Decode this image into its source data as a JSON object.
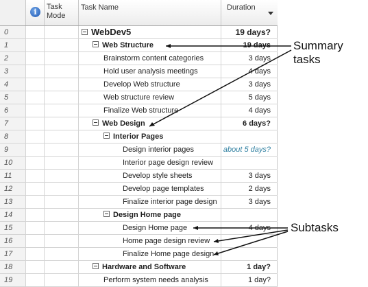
{
  "header": {
    "info_label": "i",
    "task_mode_label": "Task Mode",
    "task_name_label": "Task Name",
    "duration_label": "Duration"
  },
  "rows": [
    {
      "id": "0",
      "name": "WebDev5",
      "duration": "19 days?",
      "mode": "auto",
      "level": 0,
      "summary": true,
      "root": true
    },
    {
      "id": "1",
      "name": "Web Structure",
      "duration": "19 days",
      "mode": "auto",
      "level": 1,
      "summary": true
    },
    {
      "id": "2",
      "name": "Brainstorm content categories",
      "duration": "3 days",
      "mode": "auto",
      "level": 2
    },
    {
      "id": "3",
      "name": "Hold user analysis meetings",
      "duration": "4 days",
      "mode": "auto",
      "level": 2
    },
    {
      "id": "4",
      "name": "Develop Web structure",
      "duration": "3 days",
      "mode": "auto",
      "level": 2
    },
    {
      "id": "5",
      "name": "Web structure review",
      "duration": "5 days",
      "mode": "auto",
      "level": 2
    },
    {
      "id": "6",
      "name": "Finalize Web structure",
      "duration": "4 days",
      "mode": "auto",
      "level": 2
    },
    {
      "id": "7",
      "name": "Web Design",
      "duration": "6 days?",
      "mode": "auto",
      "level": 1,
      "summary": true
    },
    {
      "id": "8",
      "name": "Interior Pages",
      "duration": "",
      "mode": "manual",
      "level": 2,
      "summary": true
    },
    {
      "id": "9",
      "name": "Design interior pages",
      "duration": "about 5 days?",
      "mode": "manual",
      "level": 3,
      "estimate": true
    },
    {
      "id": "10",
      "name": "Interior page design review",
      "duration": "",
      "mode": "manual",
      "level": 3
    },
    {
      "id": "11",
      "name": "Develop style sheets",
      "duration": "3 days",
      "mode": "auto",
      "level": 3
    },
    {
      "id": "12",
      "name": "Develop page templates",
      "duration": "2 days",
      "mode": "auto",
      "level": 3
    },
    {
      "id": "13",
      "name": "Finalize interior page design",
      "duration": "3 days",
      "mode": "manual",
      "level": 3
    },
    {
      "id": "14",
      "name": "Design Home page",
      "duration": "",
      "mode": "manual",
      "level": 2,
      "summary": true
    },
    {
      "id": "15",
      "name": "Design Home page",
      "duration": "4 days",
      "mode": "manual",
      "level": 3
    },
    {
      "id": "16",
      "name": "Home page design review",
      "duration": "",
      "mode": "manual",
      "level": 3
    },
    {
      "id": "17",
      "name": "Finalize Home page design",
      "duration": "",
      "mode": "manual",
      "level": 3
    },
    {
      "id": "18",
      "name": "Hardware and Software",
      "duration": "1 day?",
      "mode": "auto",
      "level": 1,
      "summary": true
    },
    {
      "id": "19",
      "name": "Perform system needs analysis",
      "duration": "1 day?",
      "mode": "auto",
      "level": 2
    }
  ],
  "annotations": {
    "summary_label": "Summary tasks",
    "subtasks_label": "Subtasks"
  }
}
